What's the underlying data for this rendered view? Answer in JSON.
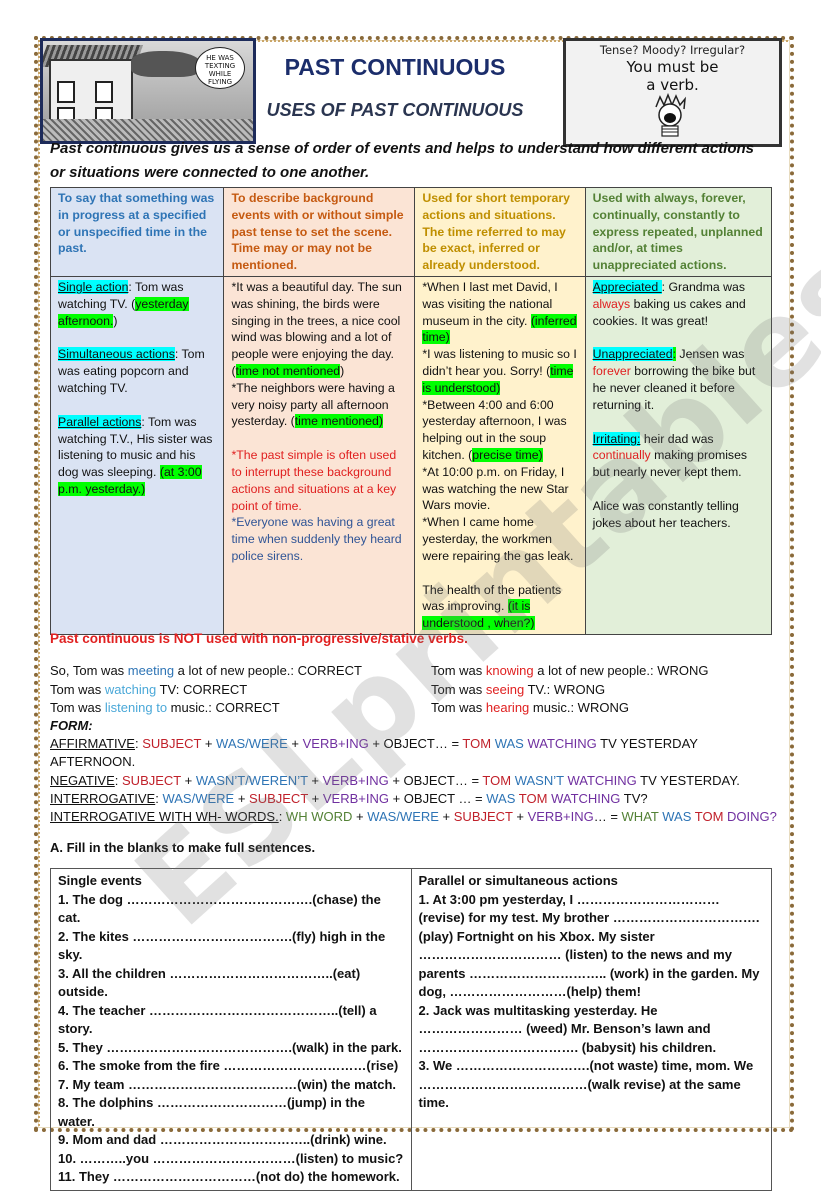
{
  "header": {
    "title": "PAST CONTINUOUS",
    "subtitle": "USES OF PAST CONTINUOUS",
    "left_cartoon": {
      "icon": "cartoon-plane-crash-image",
      "caption": "HE WAS TEXTING WHILE FLYING"
    },
    "right_cartoon": {
      "icon": "cartoon-screaming-kid-image",
      "line1": "Tense? Moody? Irregular?",
      "line2": "You must be",
      "line3": "a verb."
    }
  },
  "intro": "Past continuous gives us a sense of order of events and helps to understand how different actions or situations were connected to one another.",
  "uses_table": {
    "colors": {
      "col1_bg": "#dae3f3",
      "col2_bg": "#fbe4d5",
      "col3_bg": "#fff2cc",
      "col4_bg": "#e2efd9",
      "highlight": "#00ff00",
      "label_highlight": "#00ffff"
    },
    "headers": [
      "To say that something was in progress at a specified or unspecified time in the past.",
      "To describe background events with or without simple past tense to set the scene. Time may or may not be mentioned.",
      "Used for short temporary actions and situations. The time referred to may be exact, inferred or already understood.",
      "Used with always, forever, continually, constantly to express repeated, unplanned and/or, at times unappreciated actions."
    ],
    "col1": {
      "single_label": "Single action",
      "single_text": ": Tom was watching TV. (",
      "single_time": "yesterday afternoon.",
      "single_close": ")",
      "simul_label": "Simultaneous actions",
      "simul_text": ": Tom was eating popcorn and watching TV.",
      "parallel_label": "Parallel actions",
      "parallel_text": ": Tom was watching T.V., His sister was listening to music and his dog was sleeping. ",
      "parallel_time": "(at 3:00 p.m. yesterday.)"
    },
    "col2": {
      "p1": "*It was a beautiful day. The sun was shining, the birds were singing in the trees, a nice cool wind was blowing and a lot of people were enjoying the day.",
      "p1_open": "(",
      "p1_time": "time not mentioned",
      "p1_close": ")",
      "p2": "*The neighbors were having a very noisy party all afternoon yesterday. (",
      "p2_time": "time mentioned)",
      "p3_red": "*The past simple is often used to interrupt these background actions and situations at a key point of time.",
      "p4_blue": "*Everyone was having a great time when suddenly they heard police sirens."
    },
    "col3": {
      "p1": "*When I last met David, I was visiting the national museum in the city. ",
      "p1_time": "(inferred time)",
      "p2": "*I was listening to music so I didn’t hear you. Sorry! (",
      "p2_time": "time is understood)",
      "p3": "*Between 4:00 and 6:00 yesterday afternoon, I was helping out in the soup kitchen. (",
      "p3_time": "precise time)",
      "p4": "*At 10:00 p.m. on Friday, I was watching the new Star Wars movie.",
      "p5": "*When I came home yesterday, the workmen were repairing the gas leak.",
      "p6": "The health of the patients was improving. ",
      "p6_time": "(it is understood , when?)"
    },
    "col4": {
      "appr_label": "Appreciated ",
      "appr_colon": ": Grandma was ",
      "appr_kw": "always",
      "appr_rest": " baking us cakes and cookies. It was great!",
      "unappr_label": "Unappreciated",
      "unappr_colon": ":",
      "unappr_pre": " Jensen was ",
      "unappr_kw": "forever",
      "unappr_rest": " borrowing the bike but he never cleaned it before returning it.",
      "irr_label": "Irritating:",
      "irr_pre": " heir dad was ",
      "irr_kw": "continually",
      "irr_rest": " making promises but nearly never kept them.",
      "alice": "Alice was constantly telling jokes about her teachers."
    }
  },
  "stative": {
    "heading": "Past continuous is NOT used with non-progressive/stative verbs.",
    "correct": [
      {
        "pre": "So, Tom was ",
        "verb": "meeting",
        "post": " a lot of new people.: CORRECT"
      },
      {
        "pre": "Tom was ",
        "verb": "watching",
        "post": " TV: CORRECT"
      },
      {
        "pre": "Tom was ",
        "verb": "listening to",
        "post": " music.: CORRECT"
      }
    ],
    "wrong": [
      {
        "pre": "Tom was ",
        "verb": "knowing",
        "post": " a lot of new people.: WRONG"
      },
      {
        "pre": "Tom was ",
        "verb": "seeing",
        "post": " TV.: WRONG"
      },
      {
        "pre": "Tom was ",
        "verb": "hearing",
        "post": " music.: WRONG"
      }
    ]
  },
  "form": {
    "label": "FORM:",
    "affirmative": {
      "name": "AFFIRMATIVE",
      "subject": "SUBJECT",
      "aux": "WAS/WERE",
      "verb": "VERB+ING",
      "object": " + OBJECT… = ",
      "ex_subj": "TOM",
      "ex_aux": "WAS",
      "ex_verb": "WATCHING",
      "ex_rest": " TV YESTERDAY AFTERNOON."
    },
    "negative": {
      "name": "NEGATIVE",
      "subject": "SUBJECT",
      "aux": "WASN’T/WEREN’T",
      "verb": "VERB+ING",
      "object": " + OBJECT… = ",
      "ex_subj": "TOM",
      "ex_aux": "WASN’T",
      "ex_verb": "WATCHING",
      "ex_rest": " TV YESTERDAY."
    },
    "interrogative": {
      "name": "INTERROGATIVE",
      "aux": "WAS/WERE",
      "subject": "SUBJECT",
      "verb": "VERB+ING",
      "object": " + OBJECT … = ",
      "ex_aux": "WAS",
      "ex_subj": "TOM",
      "ex_verb": "WATCHING",
      "ex_rest": " TV?"
    },
    "wh": {
      "name": "INTERROGATIVE WITH WH- WORDS.",
      "wh": "WH WORD",
      "aux": "WAS/WERE",
      "subject": "SUBJECT",
      "verb": "VERB+ING",
      "rest": "… = ",
      "ex_wh": "WHAT",
      "ex_aux": "WAS",
      "ex_subj": "TOM",
      "ex_verb": "DOING?"
    }
  },
  "exercise": {
    "heading": "A. Fill in the blanks to make full sentences.",
    "left_title": "Single events",
    "left_items": [
      "1. The dog …………………………………….(chase) the cat.",
      "2. The kites ……………………………….(fly) high in the sky.",
      "3. All the children ………………………………..(eat) outside.",
      "4. The teacher ……………………………………..(tell) a story.",
      "5. They …………………………………….(walk) in the park.",
      "6. The smoke from the fire ……………………………(rise)",
      "7. My team …………………………………(win) the match.",
      "8. The dolphins …………………………(jump) in the water.",
      "9. Mom and dad ……………………………..(drink) wine.",
      "10. ………..you ……………………………(listen) to music?",
      "11. They ……………………………(not do) the homework."
    ],
    "right_title": "Parallel or simultaneous actions",
    "right_items": [
      "1. At 3:00 pm yesterday, I ……………………………(revise) for my test. My brother …………………………….(play) Fortnight on his Xbox. My sister …………………………… (listen) to the news and my parents ………………………….. (work) in the garden. My dog, ………………………(help) them!",
      "2. Jack was multitasking yesterday. He …………………… (weed) Mr. Benson’s lawn and ………………………………. (babysit) his children.",
      "3. We ………………………….(not waste) time, mom. We …………………………………(walk revise) at the same time."
    ]
  },
  "watermark": "ESLprintables.com"
}
